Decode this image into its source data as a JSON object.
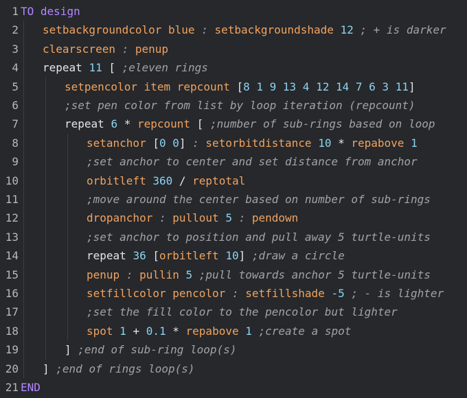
{
  "colors": {
    "background": "#26282c",
    "keyword": "#b487ff",
    "function": "#f3a35e",
    "number": "#8ed3f0",
    "text": "#e6e6e6",
    "comment": "#a0a3a8",
    "line_number": "#b8b8b8"
  },
  "lines": [
    {
      "num": "1",
      "indent": 0,
      "tokens": [
        {
          "t": "TO",
          "c": "keyword"
        },
        {
          "t": " ",
          "c": "plain"
        },
        {
          "t": "design",
          "c": "keyword"
        }
      ]
    },
    {
      "num": "2",
      "indent": 1,
      "tokens": [
        {
          "t": "setbackgroundcolor",
          "c": "func"
        },
        {
          "t": " ",
          "c": "plain"
        },
        {
          "t": "blue",
          "c": "func"
        },
        {
          "t": " : ",
          "c": "comment"
        },
        {
          "t": "setbackgroundshade",
          "c": "func"
        },
        {
          "t": " ",
          "c": "plain"
        },
        {
          "t": "12",
          "c": "num"
        },
        {
          "t": " ; + is darker",
          "c": "comment"
        }
      ]
    },
    {
      "num": "3",
      "indent": 1,
      "tokens": [
        {
          "t": "clearscreen",
          "c": "func"
        },
        {
          "t": " : ",
          "c": "comment"
        },
        {
          "t": "penup",
          "c": "func"
        }
      ]
    },
    {
      "num": "4",
      "indent": 1,
      "tokens": [
        {
          "t": "repeat",
          "c": "plain"
        },
        {
          "t": " ",
          "c": "plain"
        },
        {
          "t": "11",
          "c": "num"
        },
        {
          "t": " [ ",
          "c": "plain"
        },
        {
          "t": ";eleven rings",
          "c": "comment"
        }
      ]
    },
    {
      "num": "5",
      "indent": 2,
      "tokens": [
        {
          "t": "setpencolor",
          "c": "func"
        },
        {
          "t": " ",
          "c": "plain"
        },
        {
          "t": "item",
          "c": "func"
        },
        {
          "t": " ",
          "c": "plain"
        },
        {
          "t": "repcount",
          "c": "func"
        },
        {
          "t": " [",
          "c": "plain"
        },
        {
          "t": "8 1 9 13 4 12 14 7 6 3 11",
          "c": "num"
        },
        {
          "t": "]",
          "c": "plain"
        }
      ]
    },
    {
      "num": "6",
      "indent": 2,
      "tokens": [
        {
          "t": ";set pen color from list by loop iteration (repcount)",
          "c": "comment"
        }
      ]
    },
    {
      "num": "7",
      "indent": 2,
      "tokens": [
        {
          "t": "repeat",
          "c": "plain"
        },
        {
          "t": " ",
          "c": "plain"
        },
        {
          "t": "6",
          "c": "num"
        },
        {
          "t": " * ",
          "c": "plain"
        },
        {
          "t": "repcount",
          "c": "func"
        },
        {
          "t": " [ ",
          "c": "plain"
        },
        {
          "t": ";number of sub-rings based on loop",
          "c": "comment"
        }
      ]
    },
    {
      "num": "8",
      "indent": 3,
      "tokens": [
        {
          "t": "setanchor",
          "c": "func"
        },
        {
          "t": " [",
          "c": "plain"
        },
        {
          "t": "0 0",
          "c": "num"
        },
        {
          "t": "]",
          "c": "plain"
        },
        {
          "t": " : ",
          "c": "comment"
        },
        {
          "t": "setorbitdistance",
          "c": "func"
        },
        {
          "t": " ",
          "c": "plain"
        },
        {
          "t": "10",
          "c": "num"
        },
        {
          "t": " * ",
          "c": "plain"
        },
        {
          "t": "repabove",
          "c": "func"
        },
        {
          "t": " ",
          "c": "plain"
        },
        {
          "t": "1",
          "c": "num"
        }
      ]
    },
    {
      "num": "9",
      "indent": 3,
      "tokens": [
        {
          "t": ";set anchor to center and set distance from anchor",
          "c": "comment"
        }
      ]
    },
    {
      "num": "10",
      "indent": 3,
      "tokens": [
        {
          "t": "orbitleft",
          "c": "func"
        },
        {
          "t": " ",
          "c": "plain"
        },
        {
          "t": "360",
          "c": "num"
        },
        {
          "t": " / ",
          "c": "plain"
        },
        {
          "t": "reptotal",
          "c": "func"
        }
      ]
    },
    {
      "num": "11",
      "indent": 3,
      "tokens": [
        {
          "t": ";move around the center based on number of sub-rings",
          "c": "comment"
        }
      ]
    },
    {
      "num": "12",
      "indent": 3,
      "tokens": [
        {
          "t": "dropanchor",
          "c": "func"
        },
        {
          "t": " : ",
          "c": "comment"
        },
        {
          "t": "pullout",
          "c": "func"
        },
        {
          "t": " ",
          "c": "plain"
        },
        {
          "t": "5",
          "c": "num"
        },
        {
          "t": " : ",
          "c": "comment"
        },
        {
          "t": "pendown",
          "c": "func"
        }
      ]
    },
    {
      "num": "13",
      "indent": 3,
      "tokens": [
        {
          "t": ";set anchor to position and pull away 5 turtle-units",
          "c": "comment"
        }
      ]
    },
    {
      "num": "14",
      "indent": 3,
      "tokens": [
        {
          "t": "repeat",
          "c": "plain"
        },
        {
          "t": " ",
          "c": "plain"
        },
        {
          "t": "36",
          "c": "num"
        },
        {
          "t": " [",
          "c": "plain"
        },
        {
          "t": "orbitleft",
          "c": "func"
        },
        {
          "t": " ",
          "c": "plain"
        },
        {
          "t": "10",
          "c": "num"
        },
        {
          "t": "]",
          "c": "plain"
        },
        {
          "t": " ;draw a circle",
          "c": "comment"
        }
      ]
    },
    {
      "num": "15",
      "indent": 3,
      "tokens": [
        {
          "t": "penup",
          "c": "func"
        },
        {
          "t": " : ",
          "c": "comment"
        },
        {
          "t": "pullin",
          "c": "func"
        },
        {
          "t": " ",
          "c": "plain"
        },
        {
          "t": "5",
          "c": "num"
        },
        {
          "t": " ;pull towards anchor 5 turtle-units",
          "c": "comment"
        }
      ]
    },
    {
      "num": "16",
      "indent": 3,
      "tokens": [
        {
          "t": "setfillcolor",
          "c": "func"
        },
        {
          "t": " ",
          "c": "plain"
        },
        {
          "t": "pencolor",
          "c": "func"
        },
        {
          "t": " : ",
          "c": "comment"
        },
        {
          "t": "setfillshade",
          "c": "func"
        },
        {
          "t": " ",
          "c": "plain"
        },
        {
          "t": "-5",
          "c": "num"
        },
        {
          "t": " ; - is lighter",
          "c": "comment"
        }
      ]
    },
    {
      "num": "17",
      "indent": 3,
      "tokens": [
        {
          "t": ";set the fill color to the pencolor but lighter",
          "c": "comment"
        }
      ]
    },
    {
      "num": "18",
      "indent": 3,
      "tokens": [
        {
          "t": "spot",
          "c": "func"
        },
        {
          "t": " ",
          "c": "plain"
        },
        {
          "t": "1",
          "c": "num"
        },
        {
          "t": " + ",
          "c": "plain"
        },
        {
          "t": "0.1",
          "c": "num"
        },
        {
          "t": " * ",
          "c": "plain"
        },
        {
          "t": "repabove",
          "c": "func"
        },
        {
          "t": " ",
          "c": "plain"
        },
        {
          "t": "1",
          "c": "num"
        },
        {
          "t": " ;create a spot",
          "c": "comment"
        }
      ]
    },
    {
      "num": "19",
      "indent": 2,
      "tokens": [
        {
          "t": "]",
          "c": "plain"
        },
        {
          "t": " ;end of sub-ring loop(s)",
          "c": "comment"
        }
      ]
    },
    {
      "num": "20",
      "indent": 1,
      "tokens": [
        {
          "t": "]",
          "c": "plain"
        },
        {
          "t": " ;end of rings loop(s)",
          "c": "comment"
        }
      ]
    },
    {
      "num": "21",
      "indent": 0,
      "tokens": [
        {
          "t": "END",
          "c": "keyword"
        }
      ]
    }
  ]
}
